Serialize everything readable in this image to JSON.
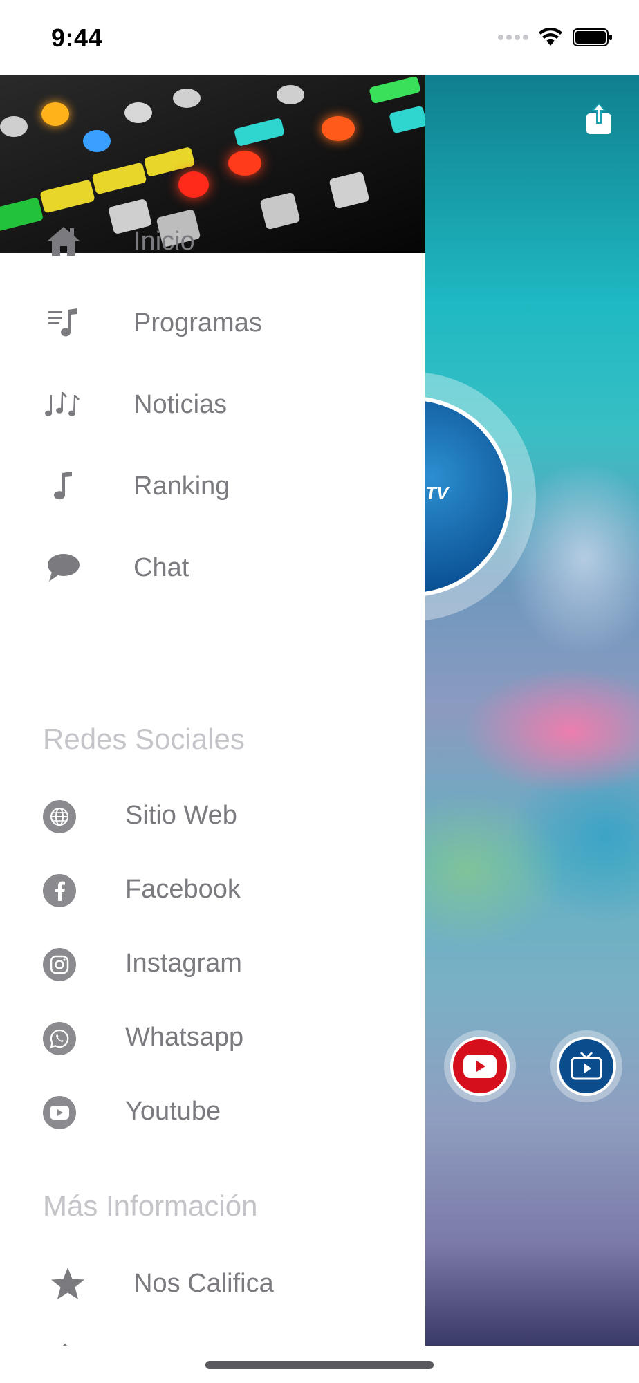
{
  "status_bar": {
    "time": "9:44"
  },
  "drawer": {
    "menu": [
      {
        "label": "Inicio",
        "icon": "home-icon"
      },
      {
        "label": "Programas",
        "icon": "playlist-icon"
      },
      {
        "label": "Noticias",
        "icon": "music-notes-icon"
      },
      {
        "label": "Ranking",
        "icon": "music-note-icon"
      },
      {
        "label": "Chat",
        "icon": "chat-bubble-icon"
      }
    ],
    "social_title": "Redes Sociales",
    "social": [
      {
        "label": "Sitio Web",
        "icon": "globe-icon"
      },
      {
        "label": "Facebook",
        "icon": "facebook-icon"
      },
      {
        "label": "Instagram",
        "icon": "instagram-icon"
      },
      {
        "label": "Whatsapp",
        "icon": "whatsapp-icon"
      },
      {
        "label": "Youtube",
        "icon": "youtube-icon"
      }
    ],
    "more_title": "Más Información",
    "more": [
      {
        "label": "Nos Califica",
        "icon": "star-icon"
      }
    ]
  },
  "background": {
    "logo_text": "TV"
  },
  "colors": {
    "menu_text": "#7a7a7f",
    "section_title": "#c4c4c9",
    "youtube_red": "#d50f1b",
    "tv_blue": "#0b4c8c"
  }
}
